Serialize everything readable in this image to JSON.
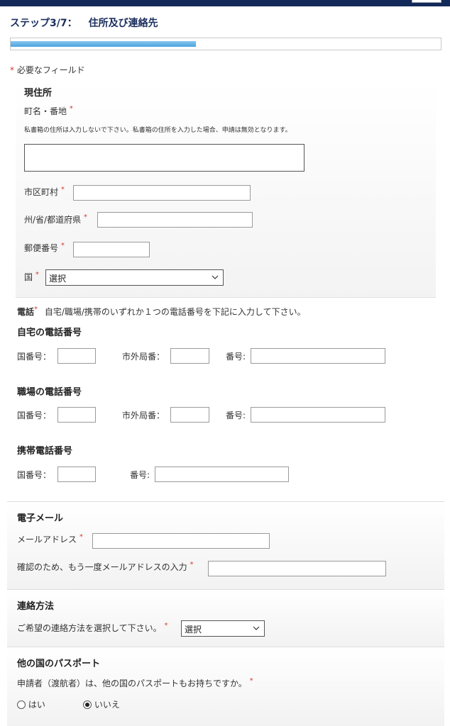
{
  "step": {
    "label": "ステップ3/7：",
    "title": "住所及び連絡先"
  },
  "progress": {
    "fraction": 0.43
  },
  "required_note": {
    "asterisk": "*",
    "text": "必要なフィールド"
  },
  "address": {
    "heading": "現住所",
    "street_label": "町名・番地",
    "street_note": "私書箱の住所は入力しないで下さい。私書箱の住所を入力した場合、申請は無効となります。",
    "street_value": "",
    "city_label": "市区町村",
    "city_value": "",
    "state_label": "州/省/都道府県",
    "state_value": "",
    "postal_label": "郵便番号",
    "postal_value": "",
    "country_label": "国",
    "country_selected": "選択"
  },
  "phone": {
    "label": "電話",
    "note": "自宅/職場/携帯のいずれか１つの電話番号を下記に入力して下さい。",
    "home_heading": "自宅の電話番号",
    "work_heading": "職場の電話番号",
    "mobile_heading": "携帯電話番号",
    "country_code_label": "国番号：",
    "area_code_label": "市外局番：",
    "number_label": "番号:"
  },
  "email": {
    "heading": "電子メール",
    "address_label": "メールアドレス",
    "address_value": "",
    "confirm_label": "確認のため、もう一度メールアドレスの入力",
    "confirm_value": ""
  },
  "contact": {
    "heading": "連絡方法",
    "prompt": "ご希望の連絡方法を選択して下さい。",
    "selected": "選択"
  },
  "passport": {
    "heading": "他の国のパスポート",
    "question": "申請者（渡航者）は、他の国のパスポートもお持ちですか。",
    "yes_label": "はい",
    "no_label": "いいえ",
    "selected": "no"
  }
}
